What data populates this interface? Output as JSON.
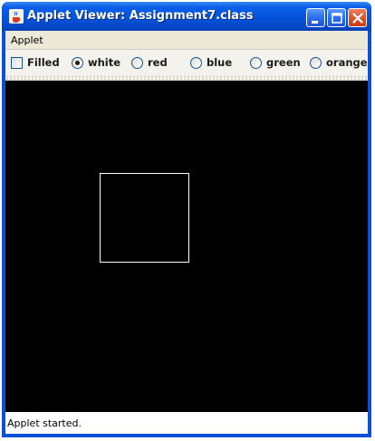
{
  "window": {
    "title": "Applet Viewer: Assignment7.class",
    "icon": "java-cup-icon",
    "buttons": [
      "minimize-icon",
      "maximize-icon",
      "close-icon"
    ]
  },
  "menubar": {
    "items": [
      {
        "label": "Applet"
      }
    ]
  },
  "controls": {
    "filled": {
      "label": "Filled",
      "checked": false
    },
    "colors": [
      {
        "label": "white",
        "selected": true
      },
      {
        "label": "red",
        "selected": false
      },
      {
        "label": "blue",
        "selected": false
      },
      {
        "label": "green",
        "selected": false
      },
      {
        "label": "orange",
        "selected": false
      }
    ]
  },
  "canvas": {
    "background": "#000000",
    "shape": {
      "type": "square-outline",
      "color": "#ffffff",
      "filled": false
    }
  },
  "status": {
    "text": "Applet started."
  },
  "colors": {
    "titlebar": "#0553db",
    "window_frame": "#0a50d8",
    "panel": "#ece9d8"
  }
}
